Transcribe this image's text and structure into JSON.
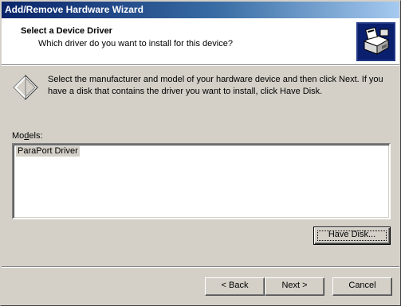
{
  "window": {
    "title": "Add/Remove Hardware Wizard"
  },
  "header": {
    "title": "Select a Device Driver",
    "subtitle": "Which driver do you want to install for this device?",
    "icon": "hardware-wizard-icon"
  },
  "body": {
    "instructions": "Select the manufacturer and model of your hardware device and then click Next. If you have a disk that contains the driver you want to install, click Have Disk.",
    "info_icon": "diamond-icon",
    "models_label": "Models:",
    "models": [
      "ParaPort Driver"
    ],
    "selected_model": "ParaPort Driver"
  },
  "buttons": {
    "have_disk": "Have Disk...",
    "back": "< Back",
    "next": "Next >",
    "cancel": "Cancel"
  }
}
